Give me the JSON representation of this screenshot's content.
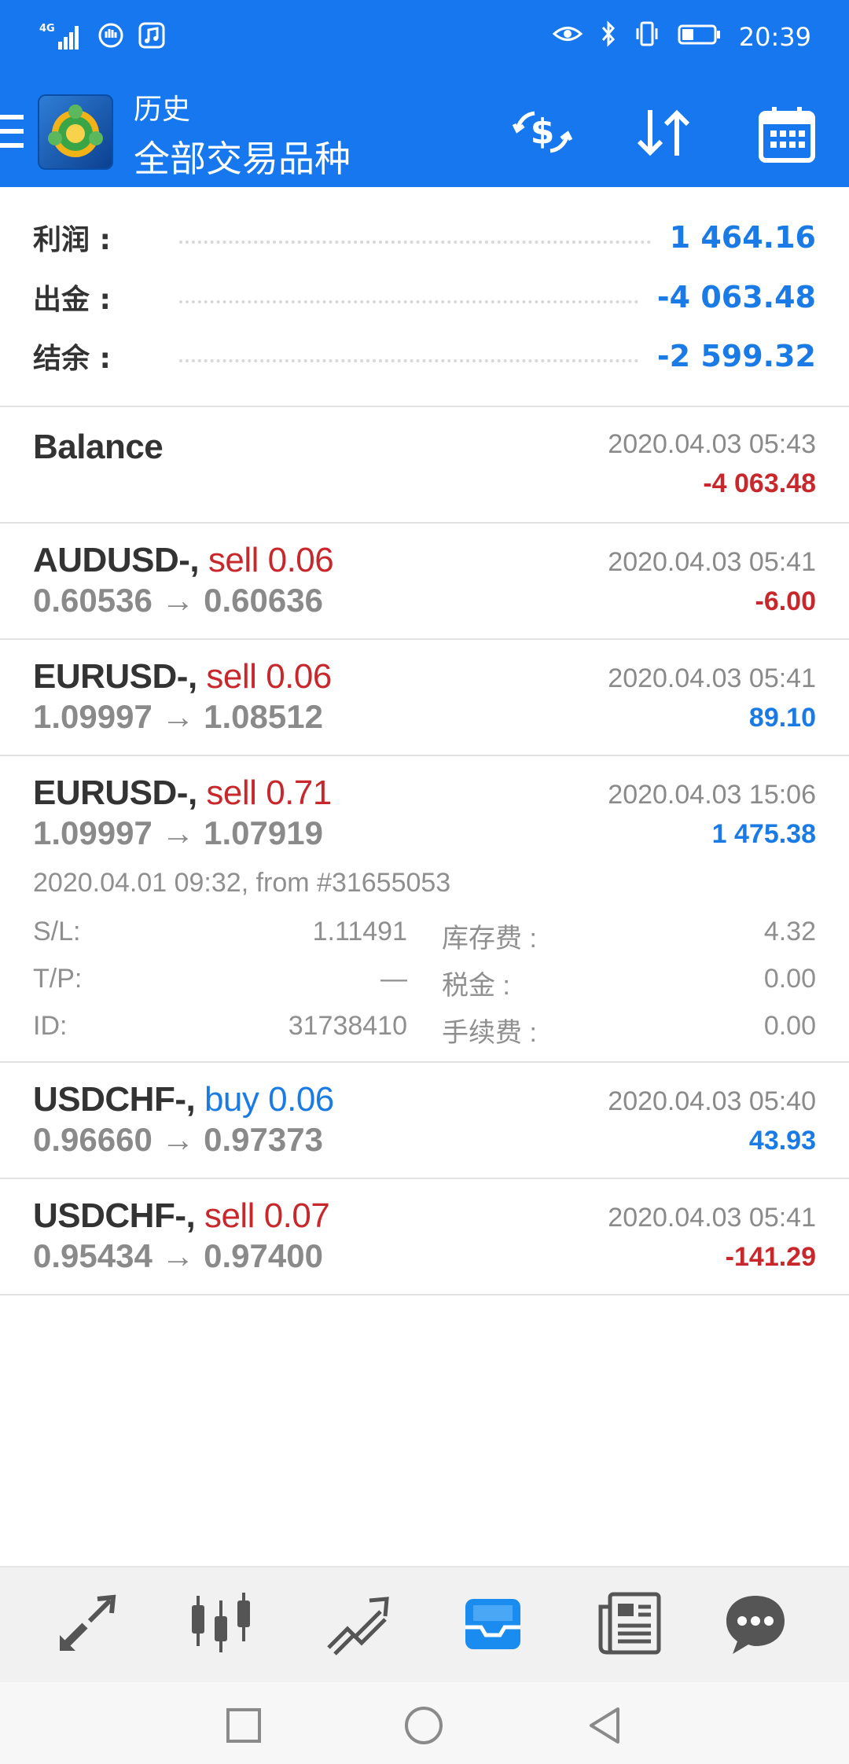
{
  "status_bar": {
    "network": "4G",
    "time": "20:39",
    "icons": [
      "signal-icon",
      "hand-icon",
      "music-icon",
      "eye-icon",
      "bluetooth-icon",
      "vibrate-icon",
      "battery-icon"
    ]
  },
  "app_bar": {
    "subtitle": "历史",
    "title": "全部交易品种",
    "icons": [
      "menu-icon",
      "app-logo",
      "currency-exchange-icon",
      "sort-icon",
      "calendar-icon"
    ]
  },
  "summary": [
    {
      "label": "利润 :",
      "value": "1 464.16"
    },
    {
      "label": "出金 :",
      "value": "-4 063.48"
    },
    {
      "label": "结余 :",
      "value": "-2 599.32"
    }
  ],
  "deals": [
    {
      "symbol": "Balance",
      "side": "",
      "volume": "",
      "prices": "",
      "time": "2020.04.03 05:43",
      "profit": "-4 063.48",
      "sign": "neg"
    },
    {
      "symbol": "AUDUSD-,",
      "side": "sell",
      "volume": "0.06",
      "prices": "0.60536 → 0.60636",
      "time": "2020.04.03 05:41",
      "profit": "-6.00",
      "sign": "neg"
    },
    {
      "symbol": "EURUSD-,",
      "side": "sell",
      "volume": "0.06",
      "prices": "1.09997 → 1.08512",
      "time": "2020.04.03 05:41",
      "profit": "89.10",
      "sign": "pos"
    },
    {
      "symbol": "EURUSD-,",
      "side": "sell",
      "volume": "0.71",
      "prices": "1.09997 → 1.07919",
      "time": "2020.04.03 15:06",
      "profit": "1 475.38",
      "sign": "pos"
    },
    {
      "symbol": "USDCHF-,",
      "side": "buy",
      "volume": "0.06",
      "prices": "0.96660 → 0.97373",
      "time": "2020.04.03 05:40",
      "profit": "43.93",
      "sign": "pos"
    },
    {
      "symbol": "USDCHF-,",
      "side": "sell",
      "volume": "0.07",
      "prices": "0.95434 → 0.97400",
      "time": "2020.04.03 05:41",
      "profit": "-141.29",
      "sign": "neg"
    }
  ],
  "expanded_detail": {
    "open_info": "2020.04.01 09:32, from #31655053",
    "sl_label": "S/L:",
    "sl_value": "1.11491",
    "tp_label": "T/P:",
    "tp_value": "—",
    "id_label": "ID:",
    "id_value": "31738410",
    "swap_label": "库存费 :",
    "swap_value": "4.32",
    "tax_label": "税金 :",
    "tax_value": "0.00",
    "commission_label": "手续费 :",
    "commission_value": "0.00"
  },
  "tab_bar": {
    "tabs": [
      "quotes-tab-icon",
      "chart-tab-icon",
      "trade-tab-icon",
      "history-tab-icon",
      "news-tab-icon",
      "chat-tab-icon"
    ],
    "active": "history-tab-icon"
  },
  "nav_bar": {
    "buttons": [
      "recents-button",
      "home-button",
      "back-button"
    ]
  },
  "colors": {
    "primary": "#1677ee",
    "negative": "#c8282b",
    "positive": "#1a7be6"
  }
}
